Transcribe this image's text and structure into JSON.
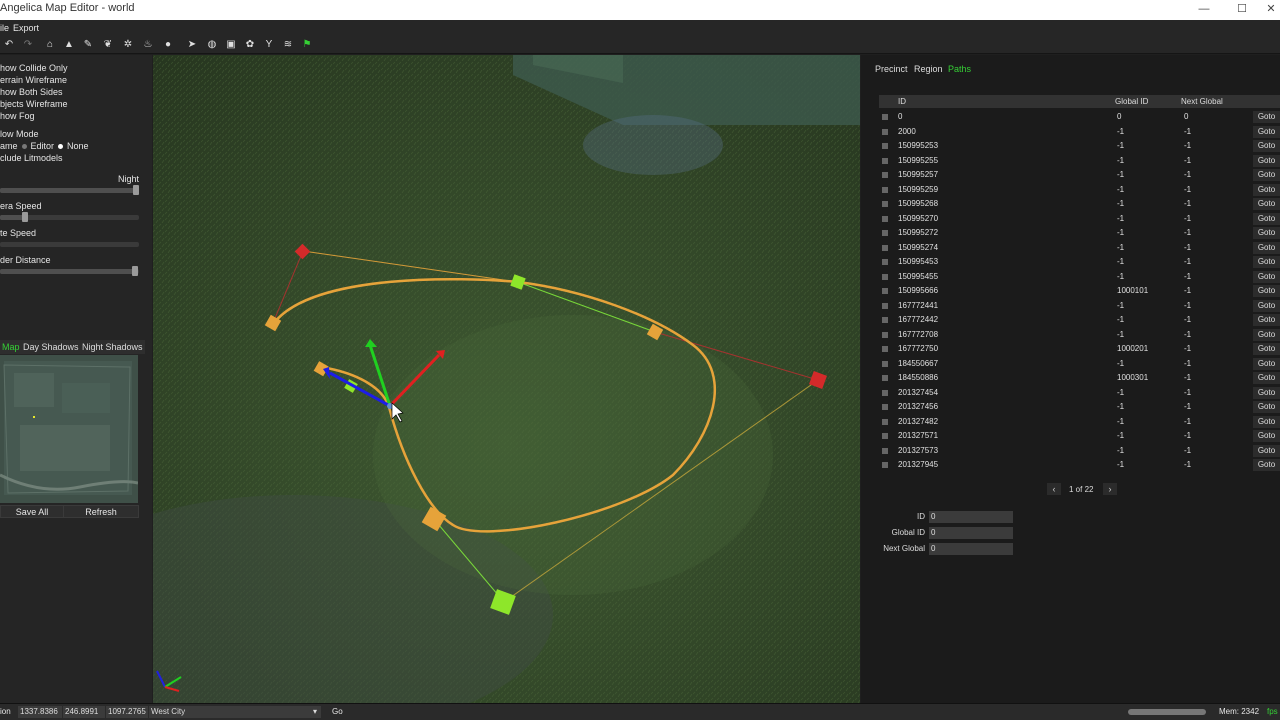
{
  "window": {
    "title": "Angelica Map Editor - world",
    "minimize": "—",
    "maximize": "☐",
    "close": "✕"
  },
  "menu": {
    "file": "ile",
    "export": "Export"
  },
  "left": {
    "show_collide": "how Collide Only",
    "terrain_wire": "errain Wireframe",
    "both_sides": "how Both Sides",
    "objects_wire": "bjects Wireframe",
    "show_fog": "how Fog",
    "flow_mode": "low Mode",
    "mode_game": "ame",
    "mode_editor": "Editor",
    "mode_none": "None",
    "include_lit": "clude Litmodels",
    "night": "Night",
    "time_value": 1.0,
    "camera_speed": "era Speed",
    "camera_value": 0.18,
    "rotate_speed": "te Speed",
    "rotate_value": 0.0,
    "render_distance": "der Distance",
    "render_value": 0.97,
    "tabs": [
      "Map",
      "Day Shadows",
      "Night Shadows"
    ],
    "save_all": "Save All",
    "refresh": "Refresh"
  },
  "right": {
    "tabs": [
      "Precinct",
      "Region",
      "Paths"
    ],
    "headers": {
      "id": "ID",
      "global": "Global ID",
      "next": "Next Global"
    },
    "goto_label": "Goto",
    "rows": [
      {
        "id": "0",
        "global": "0",
        "next": "0"
      },
      {
        "id": "2000",
        "global": "-1",
        "next": "-1"
      },
      {
        "id": "150995253",
        "global": "-1",
        "next": "-1"
      },
      {
        "id": "150995255",
        "global": "-1",
        "next": "-1"
      },
      {
        "id": "150995257",
        "global": "-1",
        "next": "-1"
      },
      {
        "id": "150995259",
        "global": "-1",
        "next": "-1"
      },
      {
        "id": "150995268",
        "global": "-1",
        "next": "-1"
      },
      {
        "id": "150995270",
        "global": "-1",
        "next": "-1"
      },
      {
        "id": "150995272",
        "global": "-1",
        "next": "-1"
      },
      {
        "id": "150995274",
        "global": "-1",
        "next": "-1"
      },
      {
        "id": "150995453",
        "global": "-1",
        "next": "-1"
      },
      {
        "id": "150995455",
        "global": "-1",
        "next": "-1"
      },
      {
        "id": "150995666",
        "global": "1000101",
        "next": "-1"
      },
      {
        "id": "167772441",
        "global": "-1",
        "next": "-1"
      },
      {
        "id": "167772442",
        "global": "-1",
        "next": "-1"
      },
      {
        "id": "167772708",
        "global": "-1",
        "next": "-1"
      },
      {
        "id": "167772750",
        "global": "1000201",
        "next": "-1"
      },
      {
        "id": "184550667",
        "global": "-1",
        "next": "-1"
      },
      {
        "id": "184550886",
        "global": "1000301",
        "next": "-1"
      },
      {
        "id": "201327454",
        "global": "-1",
        "next": "-1"
      },
      {
        "id": "201327456",
        "global": "-1",
        "next": "-1"
      },
      {
        "id": "201327482",
        "global": "-1",
        "next": "-1"
      },
      {
        "id": "201327571",
        "global": "-1",
        "next": "-1"
      },
      {
        "id": "201327573",
        "global": "-1",
        "next": "-1"
      },
      {
        "id": "201327945",
        "global": "-1",
        "next": "-1"
      }
    ],
    "page_prev": "‹",
    "page_label": "1 of 22",
    "page_next": "›",
    "form": {
      "id_label": "ID",
      "id_value": "0",
      "global_label": "Global ID",
      "global_value": "0",
      "next_label": "Next Global",
      "next_value": "0"
    }
  },
  "status": {
    "pos_label": "ion",
    "x": "1337.8386",
    "y": "246.8991",
    "z": "1097.2765",
    "city": "West City",
    "go": "Go",
    "mem": "Mem: 2342",
    "fps": "fps"
  },
  "colors": {
    "accent_green": "#35d035",
    "path_orange": "#e6a33a",
    "handle_red": "#d42a2a",
    "handle_green": "#8ee62a",
    "gizmo_red": "#e02020",
    "gizmo_green": "#20d020",
    "gizmo_blue": "#1d1de8"
  },
  "icons": [
    "undo-icon",
    "redo-icon",
    "home-icon",
    "tree-icon",
    "pen-icon",
    "leaf-icon",
    "gears-icon",
    "fire-icon",
    "bulb-icon",
    "pointer-icon",
    "globe-icon",
    "image-icon",
    "cluster-icon",
    "plant-icon",
    "water-icon",
    "flag-icon"
  ]
}
